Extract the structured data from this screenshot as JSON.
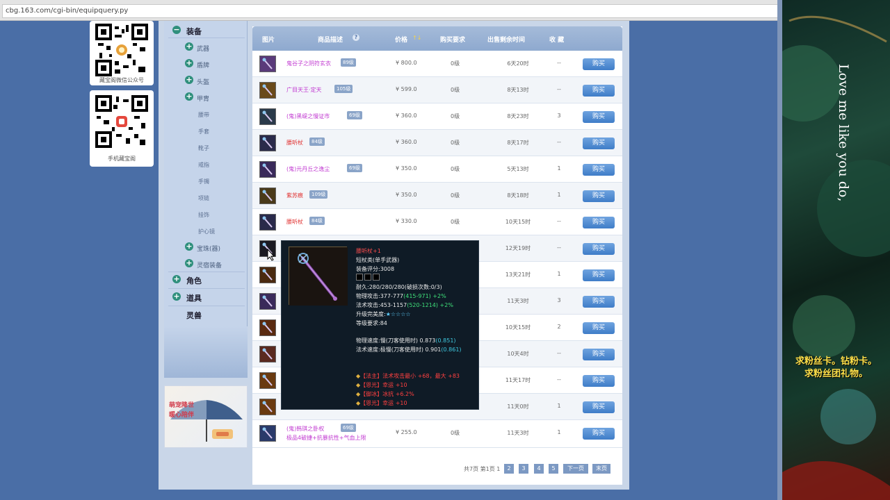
{
  "browser": {
    "url": "cbg.163.com/cgi-bin/equipquery.py"
  },
  "qr": [
    {
      "caption": "藏宝阁微信公众号"
    },
    {
      "caption": "手机藏宝阁"
    }
  ],
  "nav": {
    "equipment": "装备",
    "weapon": "武器",
    "shield": "盾牌",
    "helmet": "头盔",
    "armor": "甲胄",
    "sub": [
      "腰带",
      "手套",
      "靴子",
      "戒指",
      "手镯",
      "项链",
      "挂饰",
      "护心镜"
    ],
    "gem": "宝珠(器)",
    "spirit_equip": "灵宿装备",
    "role": "角色",
    "props": "道具",
    "pet": "灵兽"
  },
  "table": {
    "headers": {
      "image": "图片",
      "desc": "商品描述",
      "price": "价格",
      "buy_req": "购买要求",
      "time_left": "出售剩余时间",
      "favorite": "收 藏"
    },
    "buy_label": "购买",
    "rows": [
      {
        "name": "鬼谷子之阴符玄衣",
        "level": "89级",
        "price": "¥ 800.0",
        "req": "0级",
        "time": "6天20时",
        "fav": "--",
        "color": "#c13ad1"
      },
      {
        "name": "广目天王·定天",
        "level": "105级",
        "price": "¥ 599.0",
        "req": "0级",
        "time": "8天13时",
        "fav": "--",
        "color": "#c13ad1"
      },
      {
        "name": "(鬼)黑缇之慢证市",
        "level": "69级",
        "price": "¥ 360.0",
        "req": "0级",
        "time": "8天23时",
        "fav": "3",
        "color": "#c13ad1"
      },
      {
        "name": "腰听杖",
        "level": "84级",
        "price": "¥ 360.0",
        "req": "0级",
        "time": "8天17时",
        "fav": "--",
        "color": "#e0302f"
      },
      {
        "name": "(鬼)元丹丘之逸尘",
        "level": "69级",
        "price": "¥ 350.0",
        "req": "0级",
        "time": "5天13时",
        "fav": "1",
        "color": "#c13ad1"
      },
      {
        "name": "紫苏痕",
        "level": "109级",
        "price": "¥ 350.0",
        "req": "0级",
        "time": "8天18时",
        "fav": "1",
        "color": "#e0302f"
      },
      {
        "name": "腰听杖",
        "level": "84级",
        "price": "¥ 330.0",
        "req": "0级",
        "time": "10天15时",
        "fav": "--",
        "color": "#e0302f"
      },
      {
        "name": "",
        "level": "",
        "price": "",
        "req": "",
        "time": "12天19时",
        "fav": "--",
        "color": "#333"
      },
      {
        "name": "",
        "level": "",
        "price": "",
        "req": "",
        "time": "13天21时",
        "fav": "1",
        "color": "#333"
      },
      {
        "name": "",
        "level": "",
        "price": "",
        "req": "",
        "time": "11天3时",
        "fav": "3",
        "color": "#333"
      },
      {
        "name": "",
        "level": "",
        "price": "",
        "req": "",
        "time": "10天15时",
        "fav": "2",
        "color": "#333"
      },
      {
        "name": "",
        "level": "",
        "price": "",
        "req": "",
        "time": "10天4时",
        "fav": "--",
        "color": "#333"
      },
      {
        "name": "",
        "level": "",
        "price": "",
        "req": "",
        "time": "11天17时",
        "fav": "--",
        "color": "#333"
      },
      {
        "name": "",
        "level": "",
        "price": "",
        "req": "",
        "time": "11天0时",
        "fav": "1",
        "color": "#333"
      },
      {
        "name": "(鬼)韩琪之卧权",
        "level": "69级",
        "price": "¥ 255.0",
        "req": "0级",
        "time": "11天3时",
        "fav": "1",
        "color": "#c13ad1",
        "extra": "极品4破捷+抗暴抗性+气血上限"
      }
    ]
  },
  "pagination": {
    "summary": "共7页 第1页 1",
    "pages": [
      "2",
      "3",
      "4",
      "5"
    ],
    "next": "下一页",
    "last": "末页"
  },
  "tooltip": {
    "title": "腰听杖+1",
    "type": "短杖类(单手武器)",
    "score": "装备评分:3008",
    "durability": "耐久:280/280/280(破损次数:0/3)",
    "phys_atk": "物理攻击:377-777",
    "phys_atk_bonus": "(415-971) +2%",
    "mag_atk": "法术攻击:453-1157",
    "mag_atk_bonus": "(520-1214) +2%",
    "upgrade": "升级完美度:",
    "stars": "★☆☆☆☆",
    "level_req": "等级要求:84",
    "phys_speed": "物理速度:慢(刀客使用时) 0.873",
    "phys_speed_val": "(0.851)",
    "mag_speed": "法术速度:极慢(刀客使用时) 0.901",
    "mag_speed_val": "(0.861)",
    "attrs": [
      "【法主】法术攻击最小 +68，最大 +83",
      "【恩光】幸运 +10",
      "【御冰】冰抗 +6.2%",
      "【恩光】幸运 +10"
    ]
  },
  "overlay": {
    "lyric": "Love me like you do,",
    "promo_line1": "求粉丝卡。钻粉卡。",
    "promo_line2": "求粉丝团礼物。"
  }
}
